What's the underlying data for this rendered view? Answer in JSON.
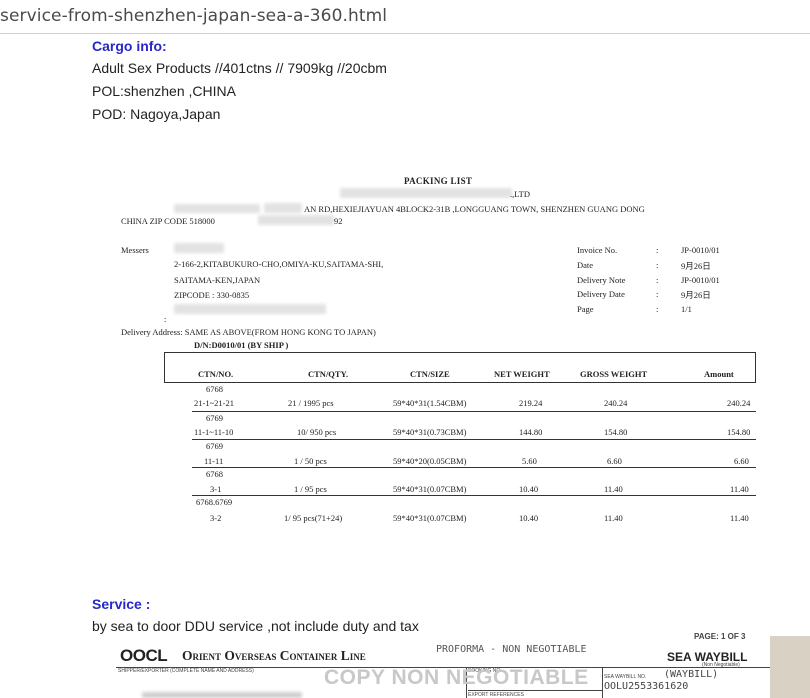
{
  "browser": {
    "url": "service-from-shenzhen-japan-sea-a-360.html"
  },
  "cargo": {
    "heading": "Cargo info:",
    "line1": "Adult Sex Products  //401ctns // 7909kg //20cbm",
    "line2": "POL:shenzhen ,CHINA",
    "line3": "POD: Nagoya,Japan"
  },
  "packing_list": {
    "title": "PACKING LIST",
    "company_suffix": ".,LTD",
    "address_line": "AN RD,HEXIEJIAYUAN 4BLOCK2-31B ,LONGGUANG TOWN, SHENZHEN GUANG DONG",
    "china_zip": "CHINA  ZIP CODE  518000",
    "phone_suffix": "92",
    "messers_label": "Messers",
    "consignee_addr1": "2-166-2,KITABUKURO-CHO,OMIYA-KU,SAITAMA-SHI,",
    "consignee_addr2": "SAITAMA-KEN,JAPAN",
    "consignee_zip": "ZIPCODE : 330-0835",
    "colon_mark": ":",
    "invoice_fields": [
      {
        "label": "Invoice No.",
        "colon": ":",
        "value": "JP-0010/01"
      },
      {
        "label": "Date",
        "colon": ":",
        "value": "9月26日"
      },
      {
        "label": "Delivery Note",
        "colon": ":",
        "value": "JP-0010/01"
      },
      {
        "label": "Delivery Date",
        "colon": ":",
        "value": "9月26日"
      },
      {
        "label": "Page",
        "colon": ":",
        "value": "1/1"
      }
    ],
    "delivery_address": "Delivery Address: SAME AS ABOVE(FROM HONG KONG TO JAPAN)",
    "dn_line": "D/N:D0010/01       (BY        SHIP )",
    "columns": [
      "CTN/NO.",
      "CTN/QTY.",
      "CTN/SIZE",
      "NET WEIGHT",
      "GROSS WEIGHT",
      "Amount"
    ],
    "rows": [
      {
        "mark": "6768",
        "ctn_no": "21-1~21-21",
        "qty": "21   / 1995 pcs",
        "size": "59*40*31(1.54CBM)",
        "net": "219.24",
        "gross": "240.24",
        "amount": "240.24"
      },
      {
        "mark": "6769",
        "ctn_no": "11-1~11-10",
        "qty": "10/ 950 pcs",
        "size": "59*40*31(0.73CBM)",
        "net": "144.80",
        "gross": "154.80",
        "amount": "154.80"
      },
      {
        "mark": "6769",
        "ctn_no": "11-11",
        "qty": "1    / 50  pcs",
        "size": "59*40*20(0.05CBM)",
        "net": "5.60",
        "gross": "6.60",
        "amount": "6.60"
      },
      {
        "mark": "6768",
        "ctn_no": "3-1",
        "qty": "1    / 95 pcs",
        "size": "59*40*31(0.07CBM)",
        "net": "10.40",
        "gross": "11.40",
        "amount": "11.40"
      },
      {
        "mark": "6768.6769",
        "ctn_no": "3-2",
        "qty": "1/ 95 pcs(71+24)",
        "size": "59*40*31(0.07CBM)",
        "net": "10.40",
        "gross": "11.40",
        "amount": "11.40"
      }
    ]
  },
  "service": {
    "heading": "Service :",
    "text": "by sea to door DDU service  ,not include duty and tax"
  },
  "waybill": {
    "page_mark": "PAGE:  1  OF  3",
    "logo": "OOCL",
    "company": "Orient Overseas Container Line",
    "proforma": "PROFORMA - NON NEGOTIABLE",
    "copy_stamp": "COPY NON NEGOTIABLE",
    "doc_type": "SEA WAYBILL",
    "non_negotiable": "(Non Negotiable)",
    "shipper_label": "SHIPPER/EXPORTER (COMPLETE NAME AND ADDRESS)",
    "booking_label": "BOOKING NO.",
    "waybill_no_label": "SEA WAYBILL NO.",
    "waybill_type": "(WAYBILL)",
    "waybill_number": "OOLU2553361620",
    "export_ref_label": "EXPORT REFERENCES"
  },
  "colors": {
    "heading_blue": "#2828c8",
    "body_text": "#222222",
    "stamp_gray": "#c8c8c8"
  }
}
